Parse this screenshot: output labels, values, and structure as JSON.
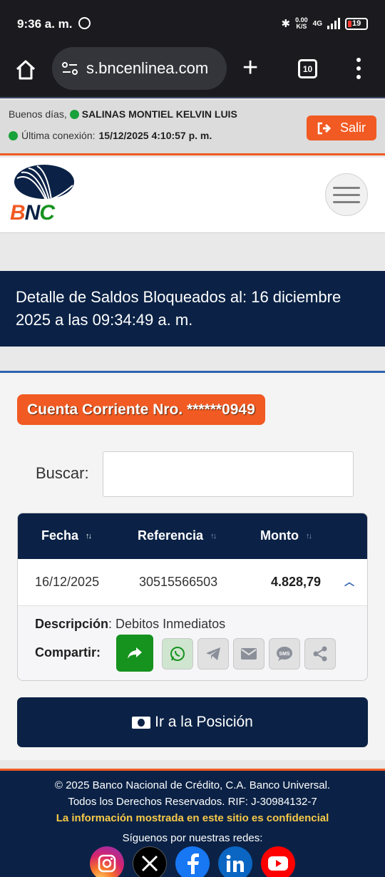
{
  "status_bar": {
    "time": "9:36 a. m.",
    "speed_top": "0.00",
    "speed_bottom": "K/S",
    "network": "4G",
    "battery": "19"
  },
  "browser": {
    "url": "s.bncenlinea.com",
    "tab_count": "10"
  },
  "greeting": {
    "prefix": "Buenos días,",
    "user_name": "SALINAS MONTIEL KELVIN LUIS",
    "last_login_label": "Última conexión:",
    "last_login_value": "15/12/2025 4:10:57 p. m.",
    "logout_label": "Salir"
  },
  "header": {
    "logo_text": "BNC"
  },
  "banner": {
    "title": "Detalle de Saldos Bloqueados al: 16 diciembre 2025 a las 09:34:49 a. m."
  },
  "account": {
    "label": "Cuenta Corriente Nro. ******0949"
  },
  "search": {
    "label": "Buscar:",
    "value": ""
  },
  "table": {
    "columns": [
      "Fecha",
      "Referencia",
      "Monto"
    ],
    "rows": [
      {
        "fecha": "16/12/2025",
        "referencia": "30515566503",
        "monto": "4.828,79",
        "descripcion_label": "Descripción",
        "descripcion_value": ": Debitos Inmediatos"
      }
    ],
    "share_label": "Compartir:"
  },
  "actions": {
    "goto_label": "Ir a la Posición"
  },
  "footer": {
    "copyright": "© 2025 Banco Nacional de Crédito, C.A. Banco Universal.",
    "rights": "Todos los Derechos Reservados. RIF: J-30984132-7",
    "confidential": "La información mostrada en este sitio es confidencial",
    "follow": "Síguenos por nuestras redes:"
  },
  "colors": {
    "navy": "#0b2246",
    "orange": "#f15a22",
    "green": "#16921f",
    "link_blue": "#2f63b0"
  }
}
